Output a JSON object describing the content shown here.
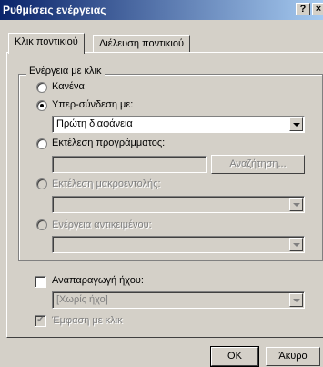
{
  "window": {
    "title": "Ρυθμίσεις ενέργειας",
    "help_label": "?",
    "close_label": "×"
  },
  "tabs": [
    {
      "label": "Κλικ ποντικιού",
      "active": true
    },
    {
      "label": "Διέλευση ποντικιού",
      "active": false
    }
  ],
  "group": {
    "legend": "Ενέργεια με κλικ"
  },
  "options": {
    "none_label": "Κανένα",
    "hyperlink_label": "Υπερ-σύνδεση με:",
    "hyperlink_value": "Πρώτη διαφάνεια",
    "run_program_label": "Εκτέλεση προγράμματος:",
    "run_program_value": "",
    "browse_label": "Αναζήτηση...",
    "run_macro_label": "Εκτέλεση μακροεντολής:",
    "run_macro_value": "",
    "object_action_label": "Ενέργεια αντικειμένου:",
    "object_action_value": ""
  },
  "sound": {
    "label": "Αναπαραγωγή ήχου:",
    "value": "[Χωρίς ήχο]",
    "checked": false
  },
  "highlight": {
    "label": "Έμφαση με κλικ",
    "checked": true
  },
  "footer": {
    "ok_label": "OK",
    "cancel_label": "Άκυρο"
  },
  "colors": {
    "title_start": "#0a246a",
    "title_end": "#a6caf0",
    "face": "#d4d0c8"
  }
}
